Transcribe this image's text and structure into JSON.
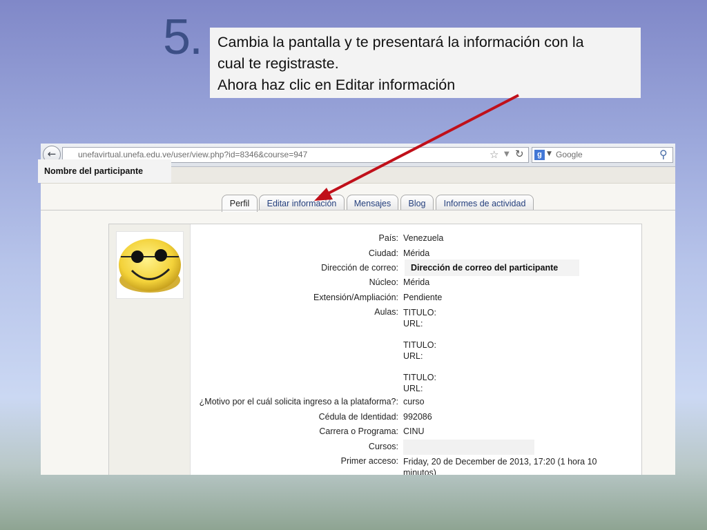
{
  "slide": {
    "step_number": "5.",
    "callout_line1": "Cambia la pantalla y te presentará la información con la",
    "callout_line2": "cual te registraste.",
    "callout_line3": "Ahora haz clic en Editar información"
  },
  "browser": {
    "url_text": "unefavirtual.unefa.edu.ve/user/view.php?id=8346&course=947",
    "search_placeholder": "Google",
    "icons": [
      "back-icon",
      "star-icon",
      "dropdown-icon",
      "reload-icon",
      "google-icon",
      "magnifier-icon"
    ]
  },
  "page": {
    "participant_name_label": "Nombre del participante",
    "tabs": [
      {
        "label": "Perfil",
        "active": true
      },
      {
        "label": "Editar información",
        "active": false
      },
      {
        "label": "Mensajes",
        "active": false
      },
      {
        "label": "Blog",
        "active": false
      },
      {
        "label": "Informes de actividad",
        "active": false
      }
    ],
    "profile": {
      "pais_label": "País:",
      "pais_value": "Venezuela",
      "ciudad_label": "Ciudad:",
      "ciudad_value": "Mérida",
      "correo_label": "Dirección de correo:",
      "correo_value": "Dirección de correo del participante",
      "nucleo_label": "Núcleo:",
      "nucleo_value": "Mérida",
      "extension_label": "Extensión/Ampliación:",
      "extension_value": "Pendiente",
      "aulas_label": "Aulas:",
      "aulas": [
        {
          "titulo": "TITULO:",
          "url": "URL:"
        },
        {
          "titulo": "TITULO:",
          "url": "URL:"
        },
        {
          "titulo": "TITULO:",
          "url": "URL:"
        }
      ],
      "motivo_label": "¿Motivo por el cuál solicita ingreso a la plataforma?:",
      "motivo_value": "curso",
      "cedula_label": "Cédula de Identidad:",
      "cedula_value": "992086",
      "carrera_label": "Carrera o Programa:",
      "carrera_value": "CINU",
      "cursos_label": "Cursos:",
      "primer_acceso_label": "Primer acceso:",
      "primer_acceso_line1": "Friday, 20 de December de 2013, 17:20  (1 hora 10",
      "primer_acceso_line2": "minutos)"
    }
  },
  "colors": {
    "step_number": "#3c4f86",
    "arrow": "#c0101a",
    "link": "#25407e"
  }
}
